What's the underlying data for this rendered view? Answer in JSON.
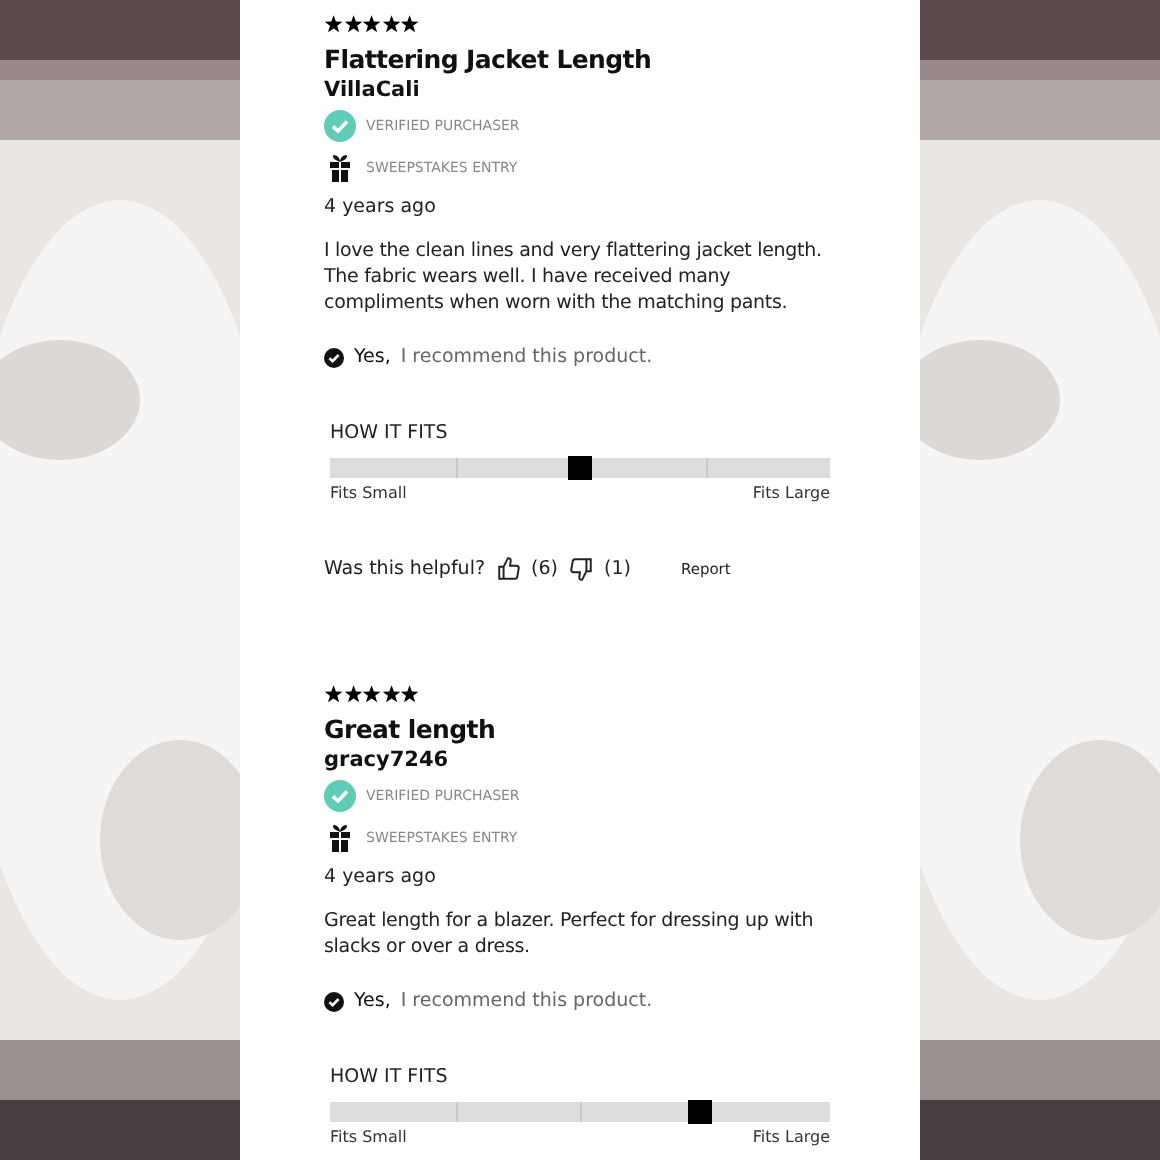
{
  "reviews": [
    {
      "stars": 5,
      "title": "Flattering Jacket Length",
      "author": "VillaCali",
      "badges": [
        {
          "kind": "verified",
          "label": "VERIFIED PURCHASER"
        },
        {
          "kind": "sweepstakes",
          "label": "SWEEPSTAKES ENTRY"
        }
      ],
      "date": "4 years ago",
      "body": "I love the clean lines and very flattering jacket length. The fabric wears well. I have received many compliments when worn with the matching pants.",
      "recommend": {
        "answer": "Yes,",
        "text": "I recommend this product."
      },
      "fit": {
        "heading": "HOW IT FITS",
        "level": 0.5,
        "low": "Fits Small",
        "high": "Fits Large"
      },
      "helpful": {
        "question": "Was this helpful?",
        "up": "(6)",
        "down": "(1)",
        "report": "Report"
      }
    },
    {
      "stars": 5,
      "title": "Great length",
      "author": "gracy7246",
      "badges": [
        {
          "kind": "verified",
          "label": "VERIFIED PURCHASER"
        },
        {
          "kind": "sweepstakes",
          "label": "SWEEPSTAKES ENTRY"
        }
      ],
      "date": "4 years ago",
      "body": "Great length for a blazer. Perfect for dressing up with slacks or over a dress.",
      "recommend": {
        "answer": "Yes,",
        "text": "I recommend this product."
      },
      "fit": {
        "heading": "HOW IT FITS",
        "level": 0.74,
        "low": "Fits Small",
        "high": "Fits Large"
      }
    }
  ]
}
